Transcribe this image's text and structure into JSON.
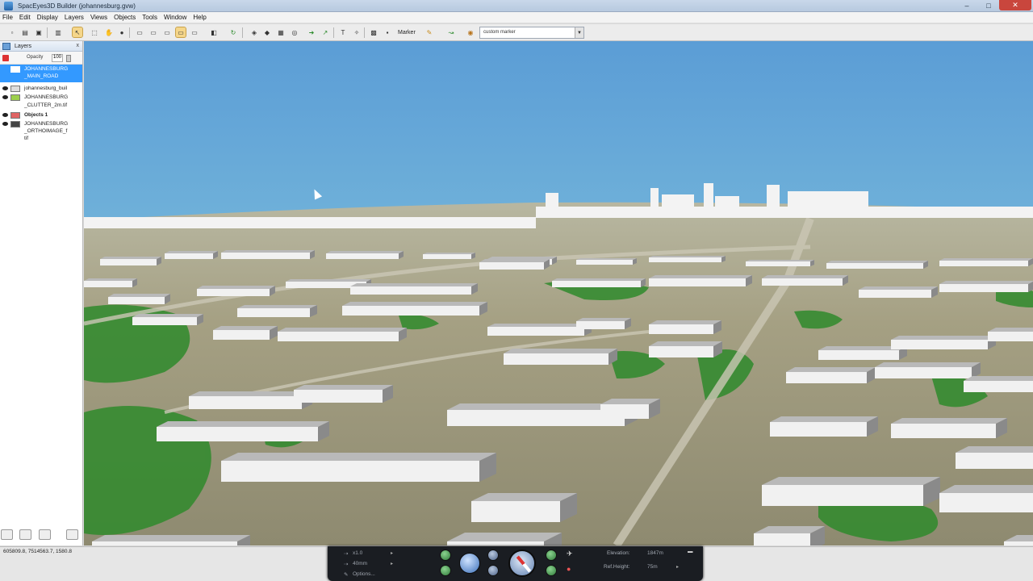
{
  "window": {
    "title": "SpacEyes3D Builder (johannesburg.gvw)",
    "min_glyph": "–",
    "max_glyph": "□",
    "close_glyph": "✕"
  },
  "menu": [
    "File",
    "Edit",
    "Display",
    "Layers",
    "Views",
    "Objects",
    "Tools",
    "Window",
    "Help"
  ],
  "toolbar": {
    "marker_label": "Marker",
    "marker_value": "custom marker"
  },
  "layers_panel": {
    "title": "Layers",
    "close_glyph": "x",
    "opacity_label": "Opacity",
    "opacity_value": "100",
    "items": [
      {
        "line1": "JOHANNESBURG",
        "line2": "_MAIN_ROAD",
        "selected": true
      },
      {
        "line1": "johannesburg_buil",
        "line2": ""
      },
      {
        "line1": "JOHANNESBURG",
        "line2": "_CLUTTER_2m.tif"
      },
      {
        "line1": "Objects 1",
        "line2": "",
        "bold": true
      },
      {
        "line1": "JOHANNESBURG",
        "line2": "_ORTHOIMAGE_f",
        "line3": "tif"
      }
    ]
  },
  "status": {
    "coordinates": "605809.8, 7514563.7, 1580.8"
  },
  "nav_panel": {
    "speed": "x1.0",
    "focal": "40mm",
    "options": "Options...",
    "elevation_label": "Elevation:",
    "elevation_value": "1847m",
    "refheight_label": "Ref.Height:",
    "refheight_value": "75m"
  },
  "colors": {
    "sky_top": "#5b9dd6",
    "sky_bottom": "#8fd2e0",
    "vegetation": "#2f8a2c",
    "building": "#f1f1f1",
    "building_shade": "#8a8a8a",
    "close_button": "#c9463d"
  },
  "icons": [
    "new-icon",
    "open-icon",
    "save-icon",
    "print-icon",
    "select-icon",
    "rectangle-select-icon",
    "hand-icon",
    "pan-icon",
    "info-icon",
    "camera-icon",
    "refresh-icon",
    "arrow-icon",
    "text-icon",
    "pencil-icon",
    "layer-icon",
    "compass-icon",
    "zoom-icon"
  ]
}
